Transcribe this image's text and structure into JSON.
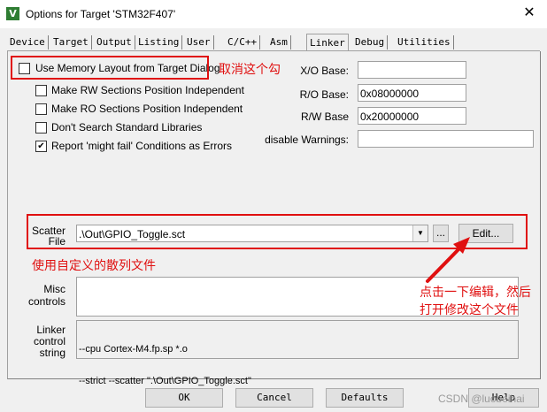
{
  "window": {
    "title": "Options for Target 'STM32F407'",
    "icon": "keil-app-icon",
    "close_glyph": "✕"
  },
  "tabs": [
    {
      "label": "Device"
    },
    {
      "label": "Target"
    },
    {
      "label": "Output"
    },
    {
      "label": "Listing"
    },
    {
      "label": "User"
    },
    {
      "label": "C/C++"
    },
    {
      "label": "Asm"
    },
    {
      "label": "Linker",
      "active": true
    },
    {
      "label": "Debug"
    },
    {
      "label": "Utilities"
    }
  ],
  "options": {
    "use_memory_layout": {
      "label": "Use Memory Layout from Target Dialog",
      "checked": false
    },
    "rw_pos_indep": {
      "label": "Make RW Sections Position Independent",
      "checked": false
    },
    "ro_pos_indep": {
      "label": "Make RO Sections Position Independent",
      "checked": false
    },
    "dont_search_libs": {
      "label": "Don't Search Standard Libraries",
      "checked": false
    },
    "report_might_fail": {
      "label": "Report 'might fail' Conditions as Errors",
      "checked": true
    }
  },
  "addresses": {
    "xo_label": "X/O Base:",
    "xo_value": "",
    "ro_label": "R/O Base:",
    "ro_value": "0x08000000",
    "rw_label": "R/W Base",
    "rw_value": "0x20000000",
    "warn_label": "disable Warnings:",
    "warn_value": ""
  },
  "scatter": {
    "label_line1": "Scatter",
    "label_line2": "File",
    "value": ".\\Out\\GPIO_Toggle.sct",
    "browse_label": "...",
    "edit_label": "Edit..."
  },
  "misc": {
    "label_line1": "Misc",
    "label_line2": "controls",
    "value": ""
  },
  "linker": {
    "label_line1": "Linker",
    "label_line2": "control",
    "label_line3": "string",
    "line1": "--cpu Cortex-M4.fp.sp *.o",
    "line2": "--strict --scatter \".\\Out\\GPIO_Toggle.sct\""
  },
  "annotations": {
    "uncheck": "取消这个勾",
    "use_custom": "使用自定义的散列文件",
    "click_edit_line1": "点击一下编辑，然后",
    "click_edit_line2": "打开修改这个文件"
  },
  "buttons": {
    "ok": "OK",
    "cancel": "Cancel",
    "defaults": "Defaults",
    "help": "Help"
  },
  "watermark": "CSDN @luobeihai",
  "colors": {
    "annotation": "#e01010",
    "dialog_bg": "#f0f0f0"
  }
}
